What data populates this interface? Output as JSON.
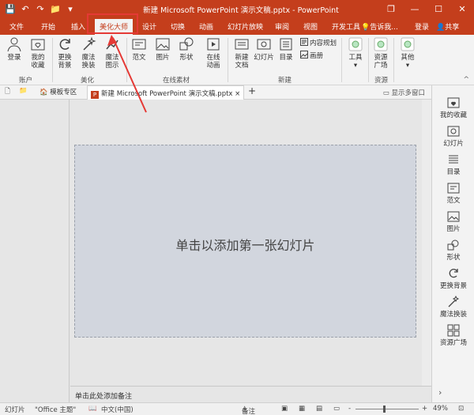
{
  "window": {
    "title": "新建 Microsoft PowerPoint 演示文稿.pptx - PowerPoint",
    "controls": {
      "restore": "❐",
      "minimize": "—",
      "maximize": "☐",
      "close": "✕"
    }
  },
  "qat": {
    "save": "💾",
    "undo": "↶",
    "redo": "↷",
    "open": "📁",
    "more": "▾"
  },
  "tabs": [
    {
      "label": "文件"
    },
    {
      "label": "开始"
    },
    {
      "label": "插入"
    },
    {
      "label": "美化大师"
    },
    {
      "label": "设计"
    },
    {
      "label": "切换"
    },
    {
      "label": "动画"
    },
    {
      "label": "幻灯片放映"
    },
    {
      "label": "审阅"
    },
    {
      "label": "视图"
    },
    {
      "label": "开发工具"
    }
  ],
  "tell_me": "告诉我...",
  "login": "登录",
  "share": "共享",
  "ribbon": {
    "account": {
      "login": "登录",
      "favorites": [
        "我的",
        "收藏"
      ],
      "group": "账户"
    },
    "beautify": {
      "replace_bg": [
        "更换",
        "背景"
      ],
      "magic_replace": [
        "魔法",
        "换装"
      ],
      "magic_chart": [
        "魔法",
        "图示"
      ],
      "group": "美化"
    },
    "online": {
      "template": "范文",
      "image": "图片",
      "shape": "形状",
      "online_anim": [
        "在线",
        "动画"
      ],
      "group": "在线素材"
    },
    "new": {
      "new_doc": [
        "新建",
        "文档"
      ],
      "slide": "幻灯片",
      "toc": "目录",
      "content_plan": "内容规划",
      "album": "画册",
      "group": "新建"
    },
    "tools": {
      "label": "工具",
      "group": ""
    },
    "resource": {
      "label": [
        "资源",
        "广场"
      ],
      "group": "资源"
    },
    "other": {
      "label": "其他"
    },
    "collapse": "^"
  },
  "doc_tabs": {
    "template_zone": "模板专区",
    "active_doc": "新建 Microsoft PowerPoint 演示文稿.pptx",
    "close": "×",
    "add": "+",
    "multi_window": "显示多窗口"
  },
  "slide": {
    "placeholder": "单击以添加第一张幻灯片"
  },
  "notes": {
    "placeholder": "单击此处添加备注"
  },
  "sidebar": [
    {
      "label": "我的收藏"
    },
    {
      "label": "幻灯片"
    },
    {
      "label": "目录"
    },
    {
      "label": "范文"
    },
    {
      "label": "图片"
    },
    {
      "label": "形状"
    },
    {
      "label": "更换背景"
    },
    {
      "label": "魔法换装"
    },
    {
      "label": "资源广场"
    }
  ],
  "sidebar_expand": "›",
  "status": {
    "slide": "幻灯片",
    "theme": "\"Office 主题\"",
    "lang": "中文(中国)",
    "notes": "备注",
    "zoom_minus": "-",
    "zoom_plus": "+",
    "zoom": "49%"
  },
  "colors": {
    "accent": "#c43e1c",
    "highlight": "#e53935"
  }
}
